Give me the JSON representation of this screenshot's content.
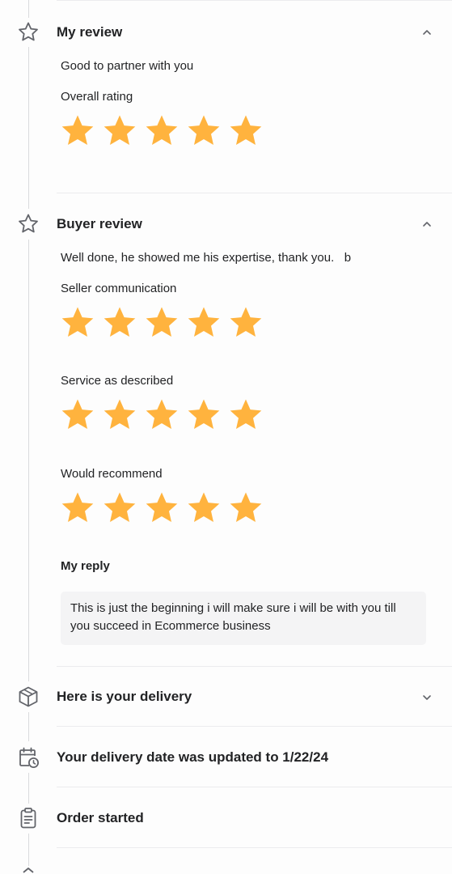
{
  "colors": {
    "star": "#ffb33e",
    "timeline": "#dadbdd",
    "reply_bg": "#f4f4f5",
    "text": "#222325"
  },
  "my_review": {
    "title": "My review",
    "icon": "star-outline-icon",
    "comment": "Good to partner with you",
    "overall_label": "Overall rating",
    "overall_rating": 5,
    "rating_max": 5
  },
  "buyer_review": {
    "title": "Buyer review",
    "icon": "star-outline-icon",
    "comment": "Well done, he showed me his expertise, thank you.   b",
    "ratings": [
      {
        "label": "Seller communication",
        "value": 5,
        "max": 5
      },
      {
        "label": "Service as described",
        "value": 5,
        "max": 5
      },
      {
        "label": "Would recommend",
        "value": 5,
        "max": 5
      }
    ],
    "reply_label": "My reply",
    "reply_text": "This is just the beginning i will make sure i will be with you till you succeed in Ecommerce business"
  },
  "delivery": {
    "title": "Here is your delivery",
    "icon": "package-icon"
  },
  "delivery_date": {
    "title": "Your delivery date was updated to 1/22/24",
    "icon": "calendar-clock-icon"
  },
  "order_started": {
    "title": "Order started",
    "icon": "clipboard-icon"
  }
}
